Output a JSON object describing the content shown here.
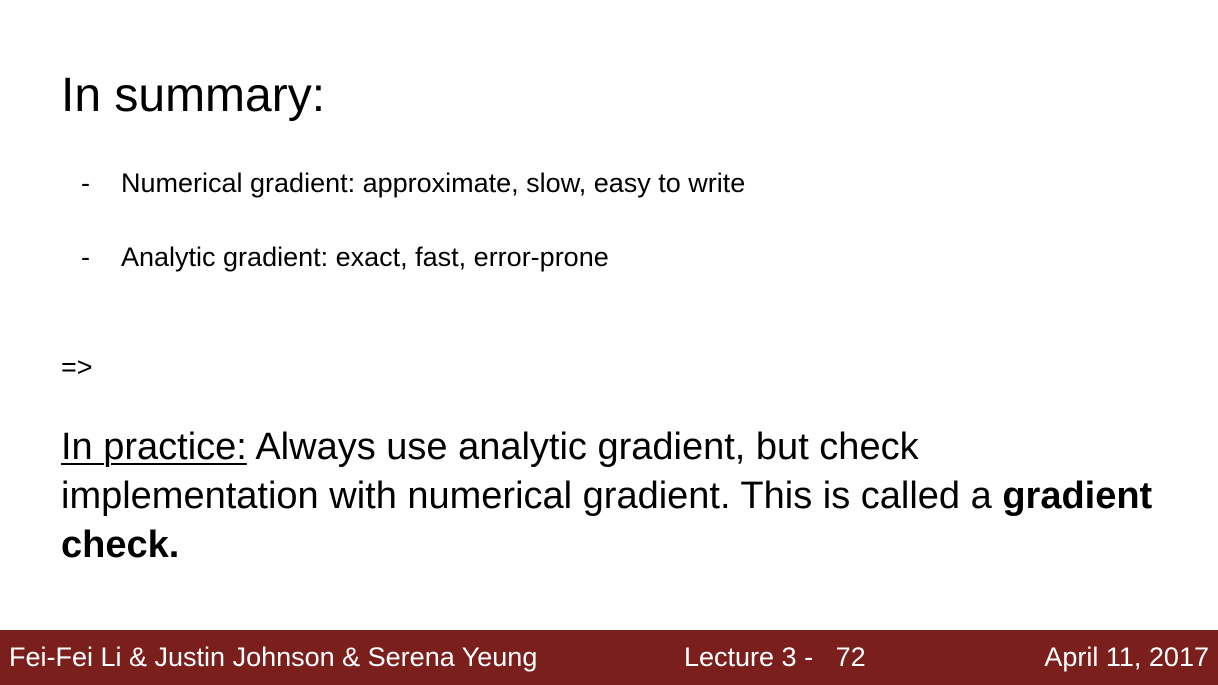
{
  "slide": {
    "title": "In summary:",
    "bullets": [
      {
        "marker": "-",
        "text": "Numerical gradient: approximate, slow, easy to write"
      },
      {
        "marker": "-",
        "text": "Analytic gradient: exact, fast, error-prone"
      }
    ],
    "arrow": "=>",
    "practice": {
      "lead": "In practice:",
      "body": " Always use analytic gradient, but check implementation with numerical gradient. This is called a ",
      "emphasis": "gradient check."
    }
  },
  "footer": {
    "authors": "Fei-Fei Li & Justin Johnson & Serena Yeung",
    "lecture": "Lecture 3 -   72",
    "date": "April 11, 2017"
  },
  "colors": {
    "footer_background": "#7a1f1b",
    "footer_text": "#ffffff"
  }
}
